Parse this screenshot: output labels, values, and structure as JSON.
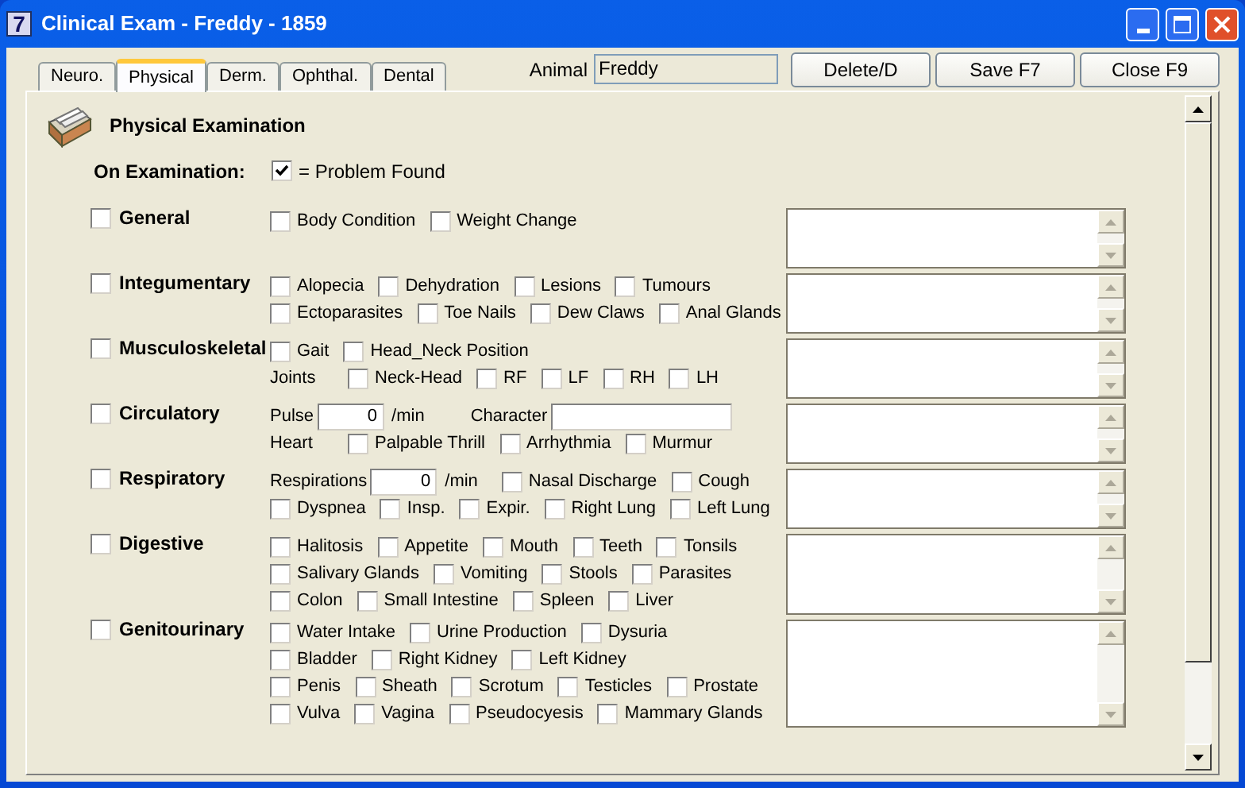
{
  "window": {
    "app_icon": "7",
    "title": "Clinical Exam - Freddy - 1859"
  },
  "tabs": [
    {
      "label": "Neuro.",
      "selected": false
    },
    {
      "label": "Physical",
      "selected": true
    },
    {
      "label": "Derm.",
      "selected": false
    },
    {
      "label": "Ophthal.",
      "selected": false
    },
    {
      "label": "Dental",
      "selected": false
    }
  ],
  "animal": {
    "label": "Animal",
    "value": "Freddy"
  },
  "buttons": [
    "Delete/D",
    "Save F7",
    "Close F9"
  ],
  "heading": "Physical Examination",
  "legend": {
    "label": "On Examination:",
    "checked": true,
    "text": "= Problem Found"
  },
  "sections": [
    {
      "label": "General",
      "checked": false,
      "lines": [
        [
          {
            "kind": "check",
            "label": "Body Condition",
            "checked": false
          },
          {
            "kind": "check",
            "label": "Weight Change",
            "checked": false
          }
        ]
      ]
    },
    {
      "label": "Integumentary",
      "checked": false,
      "lines": [
        [
          {
            "kind": "check",
            "label": "Alopecia",
            "checked": false
          },
          {
            "kind": "check",
            "label": "Dehydration",
            "checked": false
          },
          {
            "kind": "check",
            "label": "Lesions",
            "checked": false
          },
          {
            "kind": "check",
            "label": "Tumours",
            "checked": false
          }
        ],
        [
          {
            "kind": "check",
            "label": "Ectoparasites",
            "checked": false
          },
          {
            "kind": "check",
            "label": "Toe Nails",
            "checked": false
          },
          {
            "kind": "check",
            "label": "Dew Claws",
            "checked": false
          },
          {
            "kind": "check",
            "label": "Anal Glands",
            "checked": false
          }
        ]
      ]
    },
    {
      "label": "Musculoskeletal",
      "checked": false,
      "lines": [
        [
          {
            "kind": "check",
            "label": "Gait",
            "checked": false
          },
          {
            "kind": "check",
            "label": "Head_Neck Position",
            "checked": false
          }
        ],
        [
          {
            "kind": "text",
            "label": "Joints"
          },
          {
            "kind": "check",
            "label": "Neck-Head",
            "checked": false
          },
          {
            "kind": "check",
            "label": "RF",
            "checked": false
          },
          {
            "kind": "check",
            "label": "LF",
            "checked": false
          },
          {
            "kind": "check",
            "label": "RH",
            "checked": false
          },
          {
            "kind": "check",
            "label": "LH",
            "checked": false
          }
        ]
      ]
    },
    {
      "label": "Circulatory",
      "checked": false,
      "lines": [
        [
          {
            "kind": "number",
            "label": "Pulse",
            "value": "0",
            "unit": "/min"
          },
          {
            "kind": "textfield",
            "label": "Character"
          }
        ],
        [
          {
            "kind": "text",
            "label": "Heart"
          },
          {
            "kind": "check",
            "label": "Palpable Thrill",
            "checked": false
          },
          {
            "kind": "check",
            "label": "Arrhythmia",
            "checked": false
          },
          {
            "kind": "check",
            "label": "Murmur",
            "checked": false
          }
        ]
      ]
    },
    {
      "label": "Respiratory",
      "checked": false,
      "lines": [
        [
          {
            "kind": "number",
            "label": "Respirations",
            "value": "0",
            "unit": "/min"
          },
          {
            "kind": "check",
            "label": "Nasal Discharge",
            "checked": false
          },
          {
            "kind": "check",
            "label": "Cough",
            "checked": false
          }
        ],
        [
          {
            "kind": "check",
            "label": "Dyspnea",
            "checked": false
          },
          {
            "kind": "check",
            "label": "Insp.",
            "checked": false
          },
          {
            "kind": "check",
            "label": "Expir.",
            "checked": false
          },
          {
            "kind": "check",
            "label": "Right Lung",
            "checked": false
          },
          {
            "kind": "check",
            "label": "Left Lung",
            "checked": false
          }
        ]
      ]
    },
    {
      "label": "Digestive",
      "checked": false,
      "lines": [
        [
          {
            "kind": "check",
            "label": "Halitosis",
            "checked": false
          },
          {
            "kind": "check",
            "label": "Appetite",
            "checked": false
          },
          {
            "kind": "check",
            "label": "Mouth",
            "checked": false
          },
          {
            "kind": "check",
            "label": "Teeth",
            "checked": false
          },
          {
            "kind": "check",
            "label": "Tonsils",
            "checked": false
          }
        ],
        [
          {
            "kind": "check",
            "label": "Salivary Glands",
            "checked": false
          },
          {
            "kind": "check",
            "label": "Vomiting",
            "checked": false
          },
          {
            "kind": "check",
            "label": "Stools",
            "checked": false
          },
          {
            "kind": "check",
            "label": "Parasites",
            "checked": false
          }
        ],
        [
          {
            "kind": "check",
            "label": "Colon",
            "checked": false
          },
          {
            "kind": "check",
            "label": "Small Intestine",
            "checked": false
          },
          {
            "kind": "check",
            "label": "Spleen",
            "checked": false
          },
          {
            "kind": "check",
            "label": "Liver",
            "checked": false
          }
        ]
      ]
    },
    {
      "label": "Genitourinary",
      "checked": false,
      "lines": [
        [
          {
            "kind": "check",
            "label": "Water Intake",
            "checked": false
          },
          {
            "kind": "check",
            "label": "Urine Production",
            "checked": false
          },
          {
            "kind": "check",
            "label": "Dysuria",
            "checked": false
          }
        ],
        [
          {
            "kind": "check",
            "label": "Bladder",
            "checked": false
          },
          {
            "kind": "check",
            "label": "Right Kidney",
            "checked": false
          },
          {
            "kind": "check",
            "label": "Left Kidney",
            "checked": false
          }
        ],
        [
          {
            "kind": "check",
            "label": "Penis",
            "checked": false
          },
          {
            "kind": "check",
            "label": "Sheath",
            "checked": false
          },
          {
            "kind": "check",
            "label": "Scrotum",
            "checked": false
          },
          {
            "kind": "check",
            "label": "Testicles",
            "checked": false
          },
          {
            "kind": "check",
            "label": "Prostate",
            "checked": false
          }
        ],
        [
          {
            "kind": "check",
            "label": "Vulva",
            "checked": false
          },
          {
            "kind": "check",
            "label": "Vagina",
            "checked": false
          },
          {
            "kind": "check",
            "label": "Pseudocyesis",
            "checked": false
          },
          {
            "kind": "check",
            "label": "Mammary Glands",
            "checked": false
          }
        ]
      ]
    }
  ]
}
